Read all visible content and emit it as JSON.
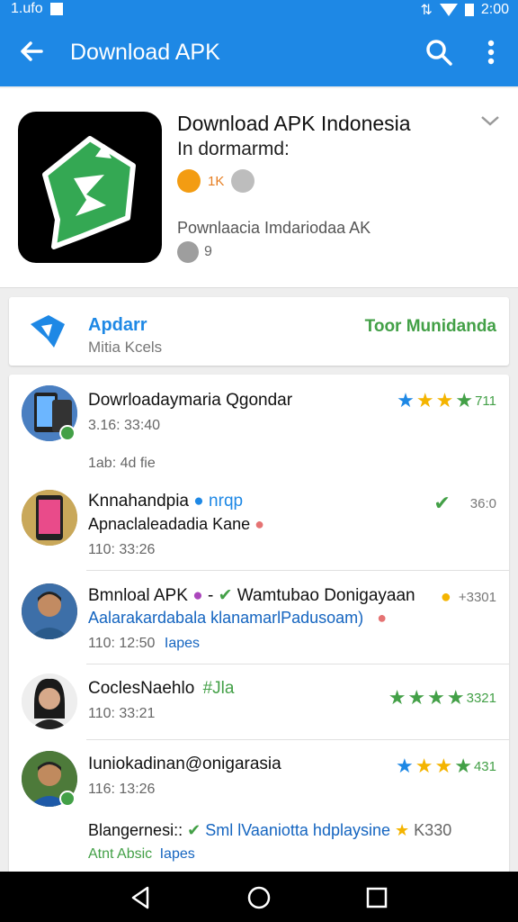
{
  "status_bar": {
    "left_text": "1.ufo",
    "time": "2:00"
  },
  "app_bar": {
    "title": "Download APK",
    "back_icon": "arrow-left-icon",
    "search_icon": "search-icon",
    "more_icon": "more-vert-icon"
  },
  "header": {
    "title": "Download APK Indonesia",
    "subtitle": "In dormarmd:",
    "count": "1K",
    "description": "Pownlaacia Imdariodaa AK",
    "rating": "9",
    "colors": {
      "icon_bg": "#000000",
      "icon_green": "#34a853"
    }
  },
  "developer": {
    "title": "Apdarr",
    "subtitle": "Mitia Kcels",
    "action": "Toor Munidanda"
  },
  "list": [
    {
      "title": "Dowrloadaymaria Qgondar",
      "time": "3.16: 33:40",
      "extra": "1ab: 4d fie",
      "stars": [
        "#1e88e5",
        "#f4b400",
        "#f4b400",
        "#43a047"
      ],
      "right_text": "711"
    },
    {
      "title": "Knnahandpia",
      "title_tag": "nrqp",
      "line2": "Apnaclaleadadia Kane",
      "time": "110: 33:26",
      "right_text": "36:0"
    },
    {
      "title": "Bmnloal APK",
      "title_tag": "Wamtubao Donigayaan",
      "line2": "Aalarakardabala klanamarlPadusoam)",
      "time": "110: 12:50",
      "time_tag": "Iapes",
      "right_text": "+3301"
    },
    {
      "title": "CoclesNaehlo",
      "title_tag": "#Jla",
      "time": "110: 33:21",
      "stars": [
        "#43a047",
        "#43a047",
        "#43a047",
        "#43a047"
      ],
      "right_text": "3321"
    },
    {
      "title": "Iuniokadinan@onigarasia",
      "time": "116: 13:26",
      "line2": "Blangernesi::",
      "line2_tag": "Sml lVaaniotta hdplaysine",
      "line2_right": "K330",
      "time2": "Atnt Absic",
      "time2_tag": "Iapes",
      "stars": [
        "#1e88e5",
        "#f4b400",
        "#f4b400",
        "#43a047"
      ],
      "right_text": "431"
    }
  ]
}
